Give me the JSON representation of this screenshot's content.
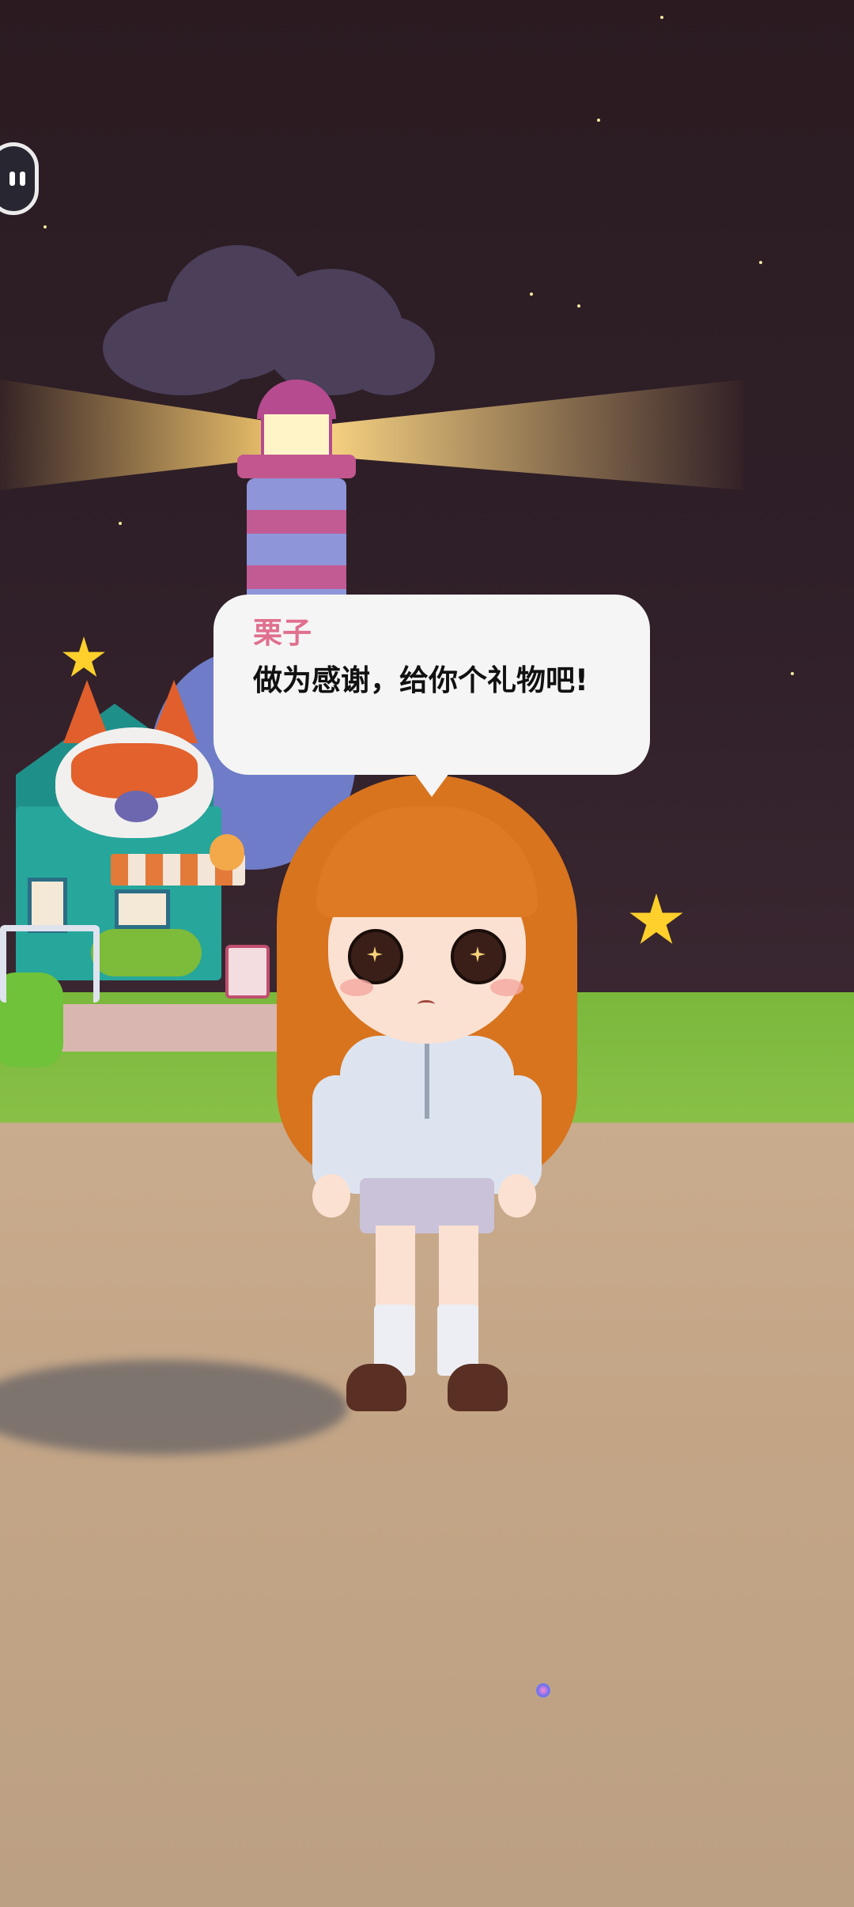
{
  "dialog": {
    "speaker": "栗子",
    "text": "做为感谢，给你个礼物吧!"
  },
  "hud": {
    "pause_icon": "pause-icon"
  },
  "colors": {
    "speaker_name": "#e0708f",
    "bubble_bg": "#f5f5f5",
    "sky": "#2b1b21",
    "ground": "#c3a586",
    "grass": "#7ab83c"
  }
}
